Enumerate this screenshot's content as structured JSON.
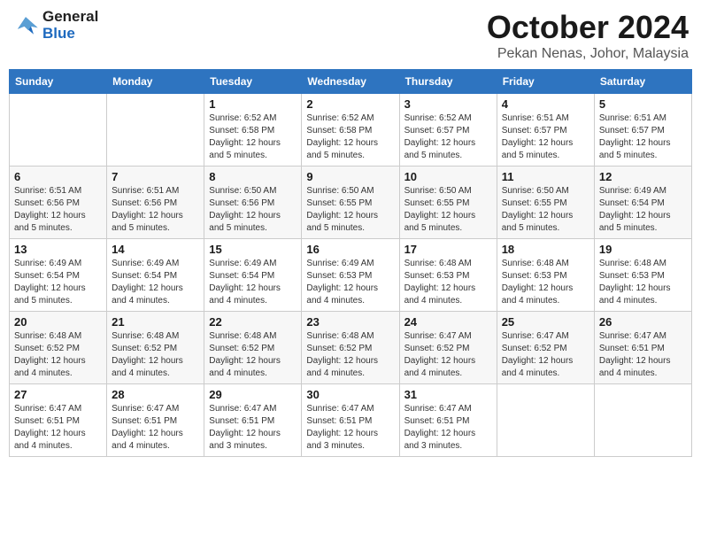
{
  "header": {
    "logo_general": "General",
    "logo_blue": "Blue",
    "month": "October 2024",
    "location": "Pekan Nenas, Johor, Malaysia"
  },
  "days_of_week": [
    "Sunday",
    "Monday",
    "Tuesday",
    "Wednesday",
    "Thursday",
    "Friday",
    "Saturday"
  ],
  "weeks": [
    [
      {
        "day": "",
        "sunrise": "",
        "sunset": "",
        "daylight": ""
      },
      {
        "day": "",
        "sunrise": "",
        "sunset": "",
        "daylight": ""
      },
      {
        "day": "1",
        "sunrise": "Sunrise: 6:52 AM",
        "sunset": "Sunset: 6:58 PM",
        "daylight": "Daylight: 12 hours and 5 minutes."
      },
      {
        "day": "2",
        "sunrise": "Sunrise: 6:52 AM",
        "sunset": "Sunset: 6:58 PM",
        "daylight": "Daylight: 12 hours and 5 minutes."
      },
      {
        "day": "3",
        "sunrise": "Sunrise: 6:52 AM",
        "sunset": "Sunset: 6:57 PM",
        "daylight": "Daylight: 12 hours and 5 minutes."
      },
      {
        "day": "4",
        "sunrise": "Sunrise: 6:51 AM",
        "sunset": "Sunset: 6:57 PM",
        "daylight": "Daylight: 12 hours and 5 minutes."
      },
      {
        "day": "5",
        "sunrise": "Sunrise: 6:51 AM",
        "sunset": "Sunset: 6:57 PM",
        "daylight": "Daylight: 12 hours and 5 minutes."
      }
    ],
    [
      {
        "day": "6",
        "sunrise": "Sunrise: 6:51 AM",
        "sunset": "Sunset: 6:56 PM",
        "daylight": "Daylight: 12 hours and 5 minutes."
      },
      {
        "day": "7",
        "sunrise": "Sunrise: 6:51 AM",
        "sunset": "Sunset: 6:56 PM",
        "daylight": "Daylight: 12 hours and 5 minutes."
      },
      {
        "day": "8",
        "sunrise": "Sunrise: 6:50 AM",
        "sunset": "Sunset: 6:56 PM",
        "daylight": "Daylight: 12 hours and 5 minutes."
      },
      {
        "day": "9",
        "sunrise": "Sunrise: 6:50 AM",
        "sunset": "Sunset: 6:55 PM",
        "daylight": "Daylight: 12 hours and 5 minutes."
      },
      {
        "day": "10",
        "sunrise": "Sunrise: 6:50 AM",
        "sunset": "Sunset: 6:55 PM",
        "daylight": "Daylight: 12 hours and 5 minutes."
      },
      {
        "day": "11",
        "sunrise": "Sunrise: 6:50 AM",
        "sunset": "Sunset: 6:55 PM",
        "daylight": "Daylight: 12 hours and 5 minutes."
      },
      {
        "day": "12",
        "sunrise": "Sunrise: 6:49 AM",
        "sunset": "Sunset: 6:54 PM",
        "daylight": "Daylight: 12 hours and 5 minutes."
      }
    ],
    [
      {
        "day": "13",
        "sunrise": "Sunrise: 6:49 AM",
        "sunset": "Sunset: 6:54 PM",
        "daylight": "Daylight: 12 hours and 5 minutes."
      },
      {
        "day": "14",
        "sunrise": "Sunrise: 6:49 AM",
        "sunset": "Sunset: 6:54 PM",
        "daylight": "Daylight: 12 hours and 4 minutes."
      },
      {
        "day": "15",
        "sunrise": "Sunrise: 6:49 AM",
        "sunset": "Sunset: 6:54 PM",
        "daylight": "Daylight: 12 hours and 4 minutes."
      },
      {
        "day": "16",
        "sunrise": "Sunrise: 6:49 AM",
        "sunset": "Sunset: 6:53 PM",
        "daylight": "Daylight: 12 hours and 4 minutes."
      },
      {
        "day": "17",
        "sunrise": "Sunrise: 6:48 AM",
        "sunset": "Sunset: 6:53 PM",
        "daylight": "Daylight: 12 hours and 4 minutes."
      },
      {
        "day": "18",
        "sunrise": "Sunrise: 6:48 AM",
        "sunset": "Sunset: 6:53 PM",
        "daylight": "Daylight: 12 hours and 4 minutes."
      },
      {
        "day": "19",
        "sunrise": "Sunrise: 6:48 AM",
        "sunset": "Sunset: 6:53 PM",
        "daylight": "Daylight: 12 hours and 4 minutes."
      }
    ],
    [
      {
        "day": "20",
        "sunrise": "Sunrise: 6:48 AM",
        "sunset": "Sunset: 6:52 PM",
        "daylight": "Daylight: 12 hours and 4 minutes."
      },
      {
        "day": "21",
        "sunrise": "Sunrise: 6:48 AM",
        "sunset": "Sunset: 6:52 PM",
        "daylight": "Daylight: 12 hours and 4 minutes."
      },
      {
        "day": "22",
        "sunrise": "Sunrise: 6:48 AM",
        "sunset": "Sunset: 6:52 PM",
        "daylight": "Daylight: 12 hours and 4 minutes."
      },
      {
        "day": "23",
        "sunrise": "Sunrise: 6:48 AM",
        "sunset": "Sunset: 6:52 PM",
        "daylight": "Daylight: 12 hours and 4 minutes."
      },
      {
        "day": "24",
        "sunrise": "Sunrise: 6:47 AM",
        "sunset": "Sunset: 6:52 PM",
        "daylight": "Daylight: 12 hours and 4 minutes."
      },
      {
        "day": "25",
        "sunrise": "Sunrise: 6:47 AM",
        "sunset": "Sunset: 6:52 PM",
        "daylight": "Daylight: 12 hours and 4 minutes."
      },
      {
        "day": "26",
        "sunrise": "Sunrise: 6:47 AM",
        "sunset": "Sunset: 6:51 PM",
        "daylight": "Daylight: 12 hours and 4 minutes."
      }
    ],
    [
      {
        "day": "27",
        "sunrise": "Sunrise: 6:47 AM",
        "sunset": "Sunset: 6:51 PM",
        "daylight": "Daylight: 12 hours and 4 minutes."
      },
      {
        "day": "28",
        "sunrise": "Sunrise: 6:47 AM",
        "sunset": "Sunset: 6:51 PM",
        "daylight": "Daylight: 12 hours and 4 minutes."
      },
      {
        "day": "29",
        "sunrise": "Sunrise: 6:47 AM",
        "sunset": "Sunset: 6:51 PM",
        "daylight": "Daylight: 12 hours and 3 minutes."
      },
      {
        "day": "30",
        "sunrise": "Sunrise: 6:47 AM",
        "sunset": "Sunset: 6:51 PM",
        "daylight": "Daylight: 12 hours and 3 minutes."
      },
      {
        "day": "31",
        "sunrise": "Sunrise: 6:47 AM",
        "sunset": "Sunset: 6:51 PM",
        "daylight": "Daylight: 12 hours and 3 minutes."
      },
      {
        "day": "",
        "sunrise": "",
        "sunset": "",
        "daylight": ""
      },
      {
        "day": "",
        "sunrise": "",
        "sunset": "",
        "daylight": ""
      }
    ]
  ]
}
